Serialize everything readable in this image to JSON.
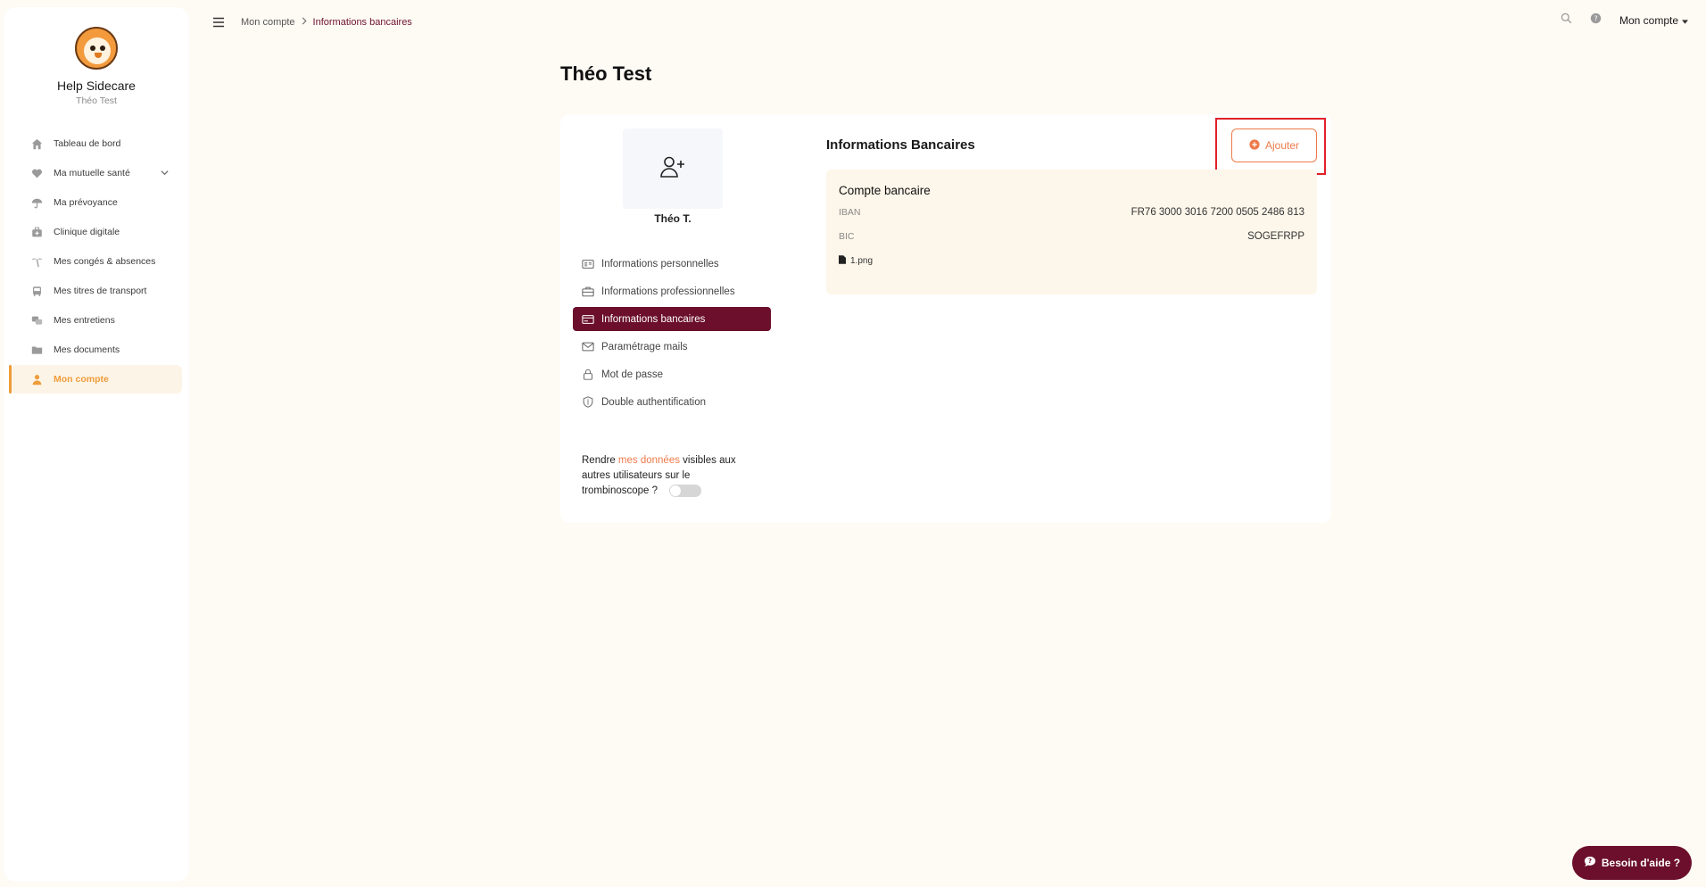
{
  "sidebar": {
    "brand_name": "Help Sidecare",
    "user_name": "Théo Test",
    "items": [
      {
        "label": "Tableau de bord",
        "icon": "home-icon"
      },
      {
        "label": "Ma mutuelle santé",
        "icon": "heart-icon"
      },
      {
        "label": "Ma prévoyance",
        "icon": "umbrella-icon"
      },
      {
        "label": "Clinique digitale",
        "icon": "medical-bag-icon"
      },
      {
        "label": "Mes congés & absences",
        "icon": "palm-tree-icon"
      },
      {
        "label": "Mes titres de transport",
        "icon": "bus-icon"
      },
      {
        "label": "Mes entretiens",
        "icon": "chat-icon"
      },
      {
        "label": "Mes documents",
        "icon": "folder-icon"
      },
      {
        "label": "Mon compte",
        "icon": "user-icon",
        "active": true
      }
    ]
  },
  "topbar": {
    "breadcrumb": [
      "Mon compte",
      "Informations bancaires"
    ],
    "account_menu": "Mon compte"
  },
  "page": {
    "title": "Théo Test"
  },
  "profile": {
    "name": "Théo T.",
    "menu": [
      {
        "label": "Informations personnelles",
        "icon": "id-card-icon"
      },
      {
        "label": "Informations professionnelles",
        "icon": "briefcase-icon"
      },
      {
        "label": "Informations bancaires",
        "icon": "credit-card-icon",
        "active": true
      },
      {
        "label": "Paramétrage mails",
        "icon": "mail-icon"
      },
      {
        "label": "Mot de passe",
        "icon": "lock-icon"
      },
      {
        "label": "Double authentification",
        "icon": "shield-icon"
      }
    ],
    "visibility": {
      "prefix": "Rendre ",
      "link": "mes données",
      "suffix": " visibles aux autres utilisateurs sur le trombinoscope ?",
      "enabled": false
    }
  },
  "bank": {
    "section_title": "Informations Bancaires",
    "add_label": "Ajouter",
    "account_title": "Compte bancaire",
    "iban_label": "IBAN",
    "iban_value": "FR76 3000 3016 7200 0505 2486 813",
    "bic_label": "BIC",
    "bic_value": "SOGEFRPP",
    "file_name": "1.png"
  },
  "help_button": "Besoin d'aide ?",
  "colors": {
    "accent_orange": "#ee9c3a",
    "add_orange": "#ee7a4a",
    "burgundy": "#6b0f2c",
    "highlight_red": "#e0202a",
    "background": "#fefaf4"
  }
}
